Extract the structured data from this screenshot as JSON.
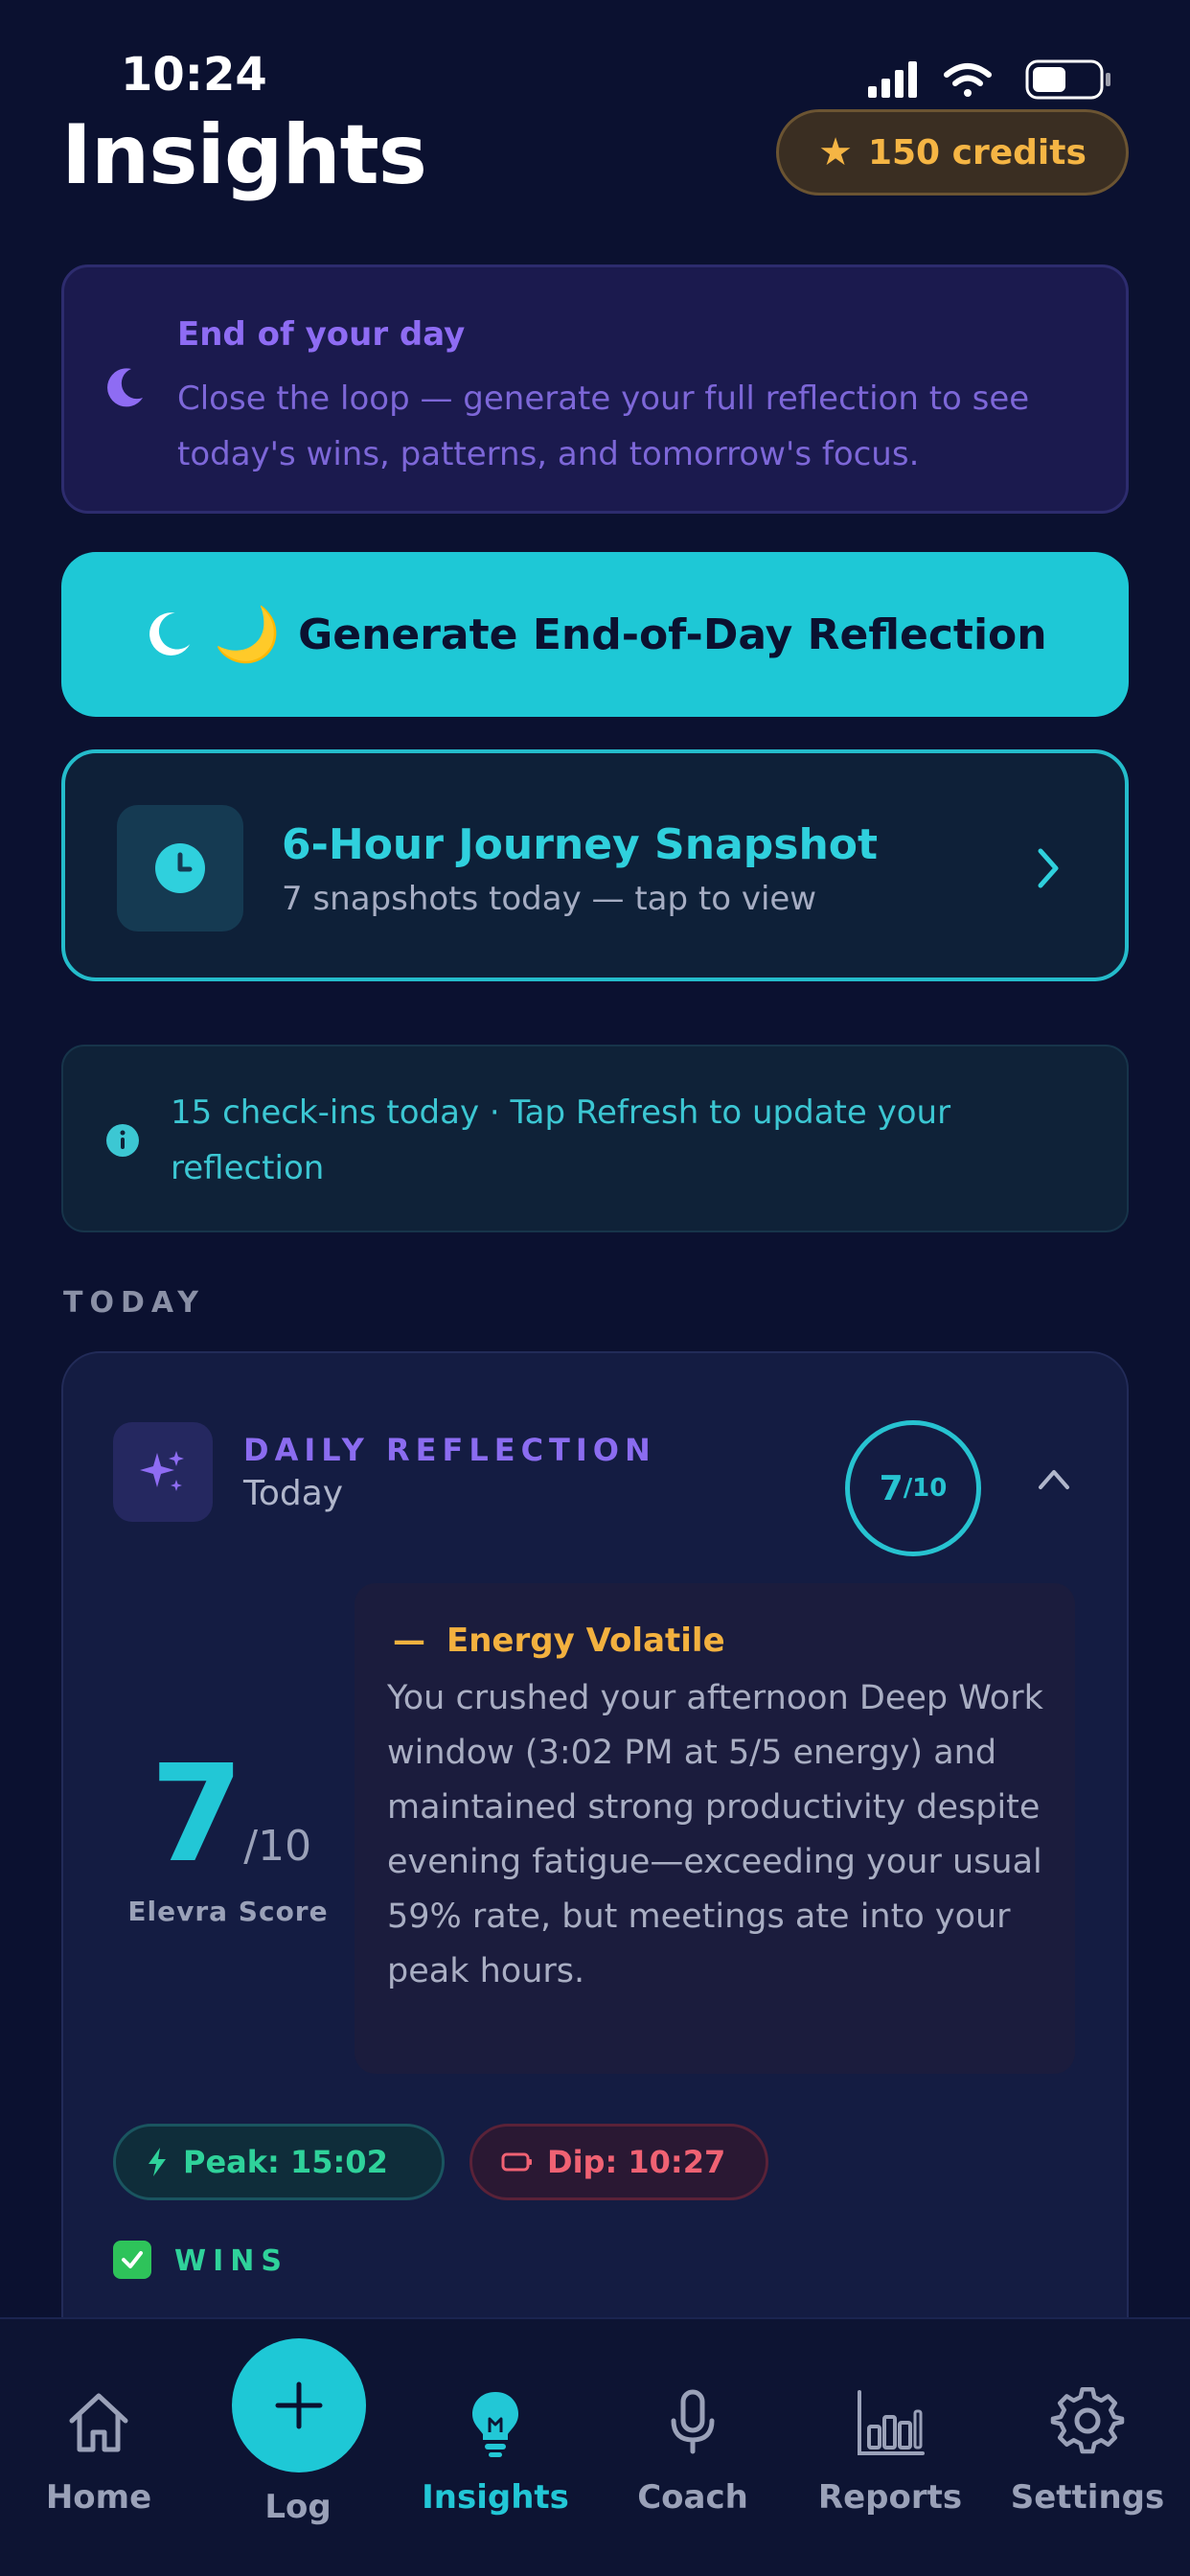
{
  "status": {
    "time": "10:24"
  },
  "header": {
    "title": "Insights",
    "credits": "150 credits"
  },
  "eod": {
    "title": "End of your day",
    "body": "Close the loop — generate your full reflection to see today's wins, patterns, and tomorrow's focus."
  },
  "generate": {
    "icon": "☾",
    "emoji": "🌙",
    "label": "Generate End-of-Day Reflection"
  },
  "journey": {
    "title": "6-Hour Journey Snapshot",
    "subtitle": "7 snapshots today — tap to view"
  },
  "checkins": {
    "text": "15 check-ins today · Tap Refresh to update your reflection"
  },
  "section": {
    "today": "TODAY"
  },
  "reflection": {
    "label": "DAILY REFLECTION",
    "subtitle": "Today",
    "ring_score": "7",
    "ring_max": "/10",
    "score": "7",
    "score_max": "/10",
    "score_label": "Elevra Score",
    "insight_dash": "—",
    "insight_title": "Energy Volatile",
    "insight_body": "You crushed your afternoon Deep Work window (3:02 PM at 5/5 energy) and maintained strong productivity despite evening fatigue—exceeding your usual 59% rate, but meetings ate into your peak hours.",
    "peak": "Peak: 15:02",
    "dip": "Dip: 10:27",
    "wins": "WINS"
  },
  "nav": {
    "home": "Home",
    "log": "Log",
    "insights": "Insights",
    "coach": "Coach",
    "reports": "Reports",
    "settings": "Settings",
    "active": "insights"
  },
  "colors": {
    "background": "#0b1130",
    "accent": "#1ec8d6",
    "purple": "#8e6cf3",
    "gold": "#f5b544",
    "green": "#2fd29a",
    "red": "#f06273"
  }
}
